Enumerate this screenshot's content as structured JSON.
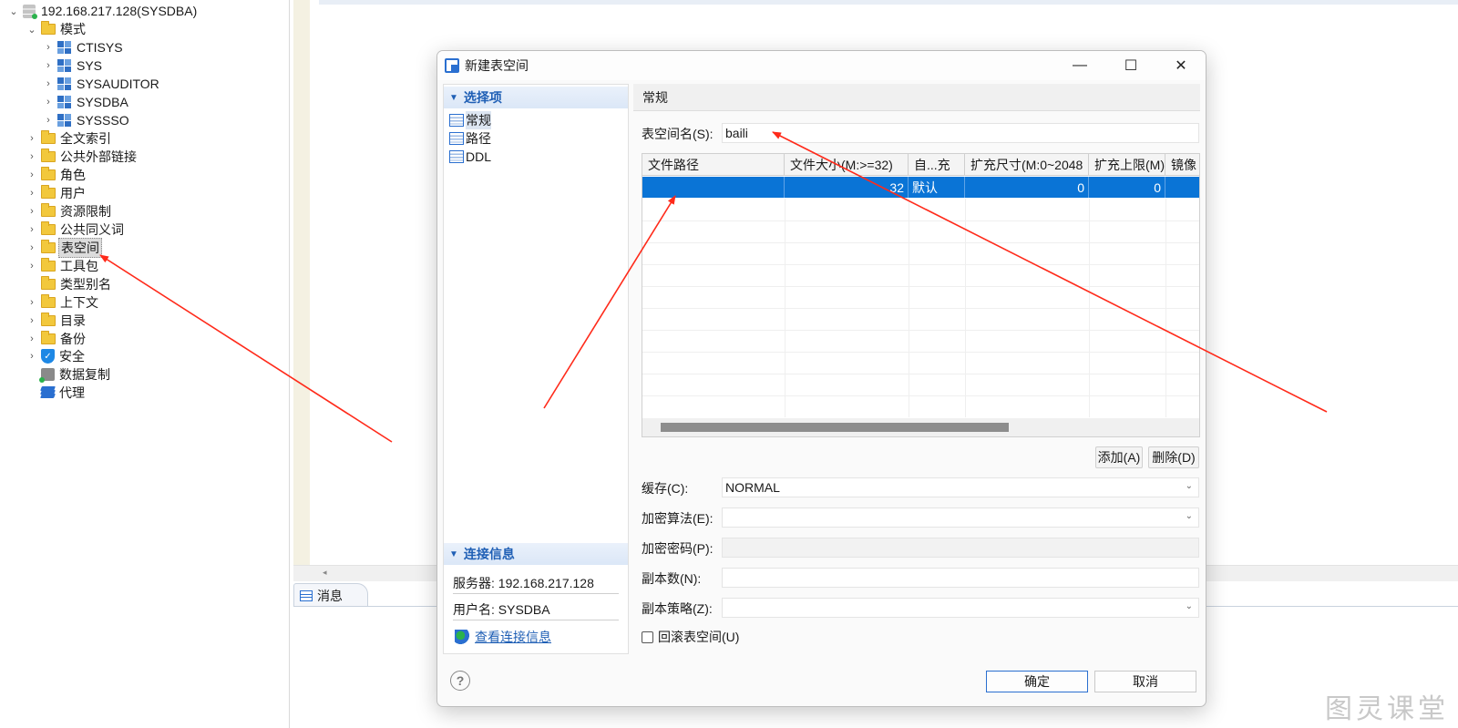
{
  "tree": {
    "root": "192.168.217.128(SYSDBA)",
    "schema_folder": "模式",
    "schemas": [
      "CTISYS",
      "SYS",
      "SYSAUDITOR",
      "SYSDBA",
      "SYSSSO"
    ],
    "folders": [
      "全文索引",
      "公共外部链接",
      "角色",
      "用户",
      "资源限制",
      "公共同义词",
      "表空间",
      "工具包",
      "类型别名",
      "上下文",
      "目录",
      "备份"
    ],
    "security": "安全",
    "replication": "数据复制",
    "agent": "代理"
  },
  "messages_tab": "消息",
  "dialog": {
    "title": "新建表空间",
    "minimize": "—",
    "maximize": "☐",
    "close": "✕",
    "options_header": "选择项",
    "options": [
      "常规",
      "路径",
      "DDL"
    ],
    "conn_header": "连接信息",
    "server": "服务器: 192.168.217.128",
    "user": "用户名: SYSDBA",
    "view_conn": "查看连接信息",
    "section_title": "常规",
    "name_label": "表空间名(S):",
    "name_value": "baili",
    "grid": {
      "headers": [
        "文件路径",
        "文件大小(M:>=32)",
        "自...充",
        "扩充尺寸(M:0~2048",
        "扩充上限(M)",
        "镜像"
      ],
      "row": [
        "",
        "32",
        "默认",
        "0",
        "0",
        ""
      ]
    },
    "add_btn": "添加(A)",
    "delete_btn": "删除(D)",
    "cache_label": "缓存(C):",
    "cache_value": "NORMAL",
    "encrypt_alg_label": "加密算法(E):",
    "encrypt_alg_value": "",
    "encrypt_pwd_label": "加密密码(P):",
    "replicas_label": "副本数(N):",
    "replica_policy_label": "副本策略(Z):",
    "rollback_label": "回滚表空间(U)",
    "rollback_checked": false,
    "help_icon": "?",
    "ok_btn": "确定",
    "cancel_btn": "取消"
  },
  "watermark": "图灵课堂",
  "colors": {
    "accent": "#0a74d6",
    "arrow": "#ff2a1a",
    "folder": "#f2c83c"
  }
}
